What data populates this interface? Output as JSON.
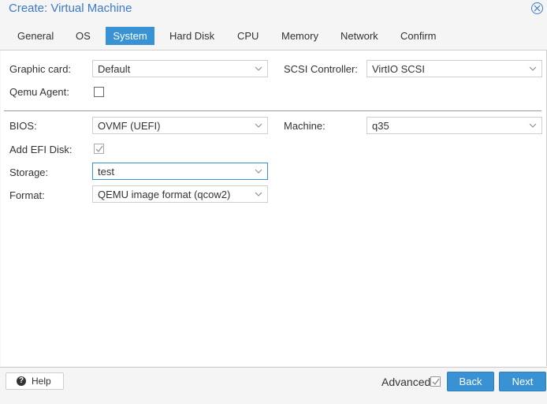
{
  "window": {
    "title": "Create: Virtual Machine"
  },
  "tabs": [
    {
      "label": "General"
    },
    {
      "label": "OS"
    },
    {
      "label": "System"
    },
    {
      "label": "Hard Disk"
    },
    {
      "label": "CPU"
    },
    {
      "label": "Memory"
    },
    {
      "label": "Network"
    },
    {
      "label": "Confirm"
    }
  ],
  "active_tab": "System",
  "form": {
    "graphic_card": {
      "label": "Graphic card:",
      "value": "Default"
    },
    "scsi_controller": {
      "label": "SCSI Controller:",
      "value": "VirtIO SCSI"
    },
    "qemu_agent": {
      "label": "Qemu Agent:",
      "checked": false
    },
    "bios": {
      "label": "BIOS:",
      "value": "OVMF (UEFI)"
    },
    "machine": {
      "label": "Machine:",
      "value": "q35"
    },
    "add_efi_disk": {
      "label": "Add EFI Disk:",
      "checked": true,
      "disabled": true
    },
    "storage": {
      "label": "Storage:",
      "value": "test"
    },
    "format": {
      "label": "Format:",
      "value": "QEMU image format (qcow2)"
    }
  },
  "footer": {
    "help_label": "Help",
    "help_icon": "?",
    "advanced_label": "Advanced",
    "advanced_checked": true,
    "back_label": "Back",
    "next_label": "Next"
  },
  "colors": {
    "accent": "#3892d4",
    "title": "#3c7ac8"
  }
}
